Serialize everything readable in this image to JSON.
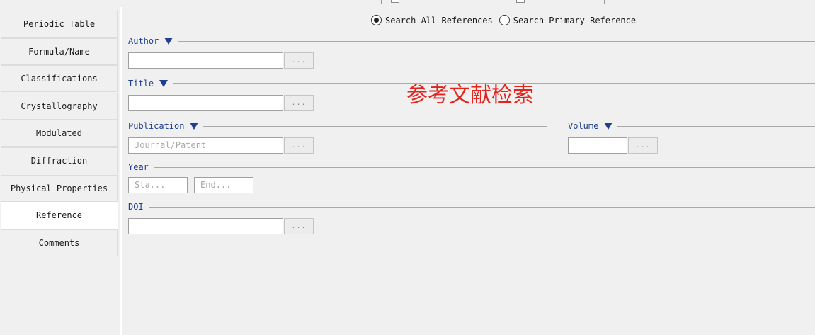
{
  "sidebar": {
    "items": [
      {
        "label": "Periodic Table",
        "active": false
      },
      {
        "label": "Formula/Name",
        "active": false
      },
      {
        "label": "Classifications",
        "active": false
      },
      {
        "label": "Crystallography",
        "active": false
      },
      {
        "label": "Modulated",
        "active": false
      },
      {
        "label": "Diffraction",
        "active": false
      },
      {
        "label": "Physical Properties",
        "active": false
      },
      {
        "label": "Reference",
        "active": true
      },
      {
        "label": "Comments",
        "active": false
      }
    ]
  },
  "search_scope": {
    "options": [
      {
        "label": "Search All References",
        "selected": true
      },
      {
        "label": "Search Primary Reference",
        "selected": false
      }
    ]
  },
  "sections": {
    "author": {
      "label": "Author",
      "value": "",
      "browse_label": "..."
    },
    "title": {
      "label": "Title",
      "value": "",
      "browse_label": "..."
    },
    "publication": {
      "label": "Publication",
      "placeholder": "Journal/Patent",
      "browse_label": "..."
    },
    "volume": {
      "label": "Volume",
      "value": "",
      "browse_label": "..."
    },
    "year": {
      "label": "Year",
      "start_placeholder": "Sta...",
      "end_placeholder": "End..."
    },
    "doi": {
      "label": "DOI",
      "value": "",
      "browse_label": "..."
    }
  },
  "watermark": "参考文献检索",
  "colors": {
    "accent": "#1f3f8f",
    "watermark": "#e4231c",
    "background": "#f0f0f0"
  }
}
